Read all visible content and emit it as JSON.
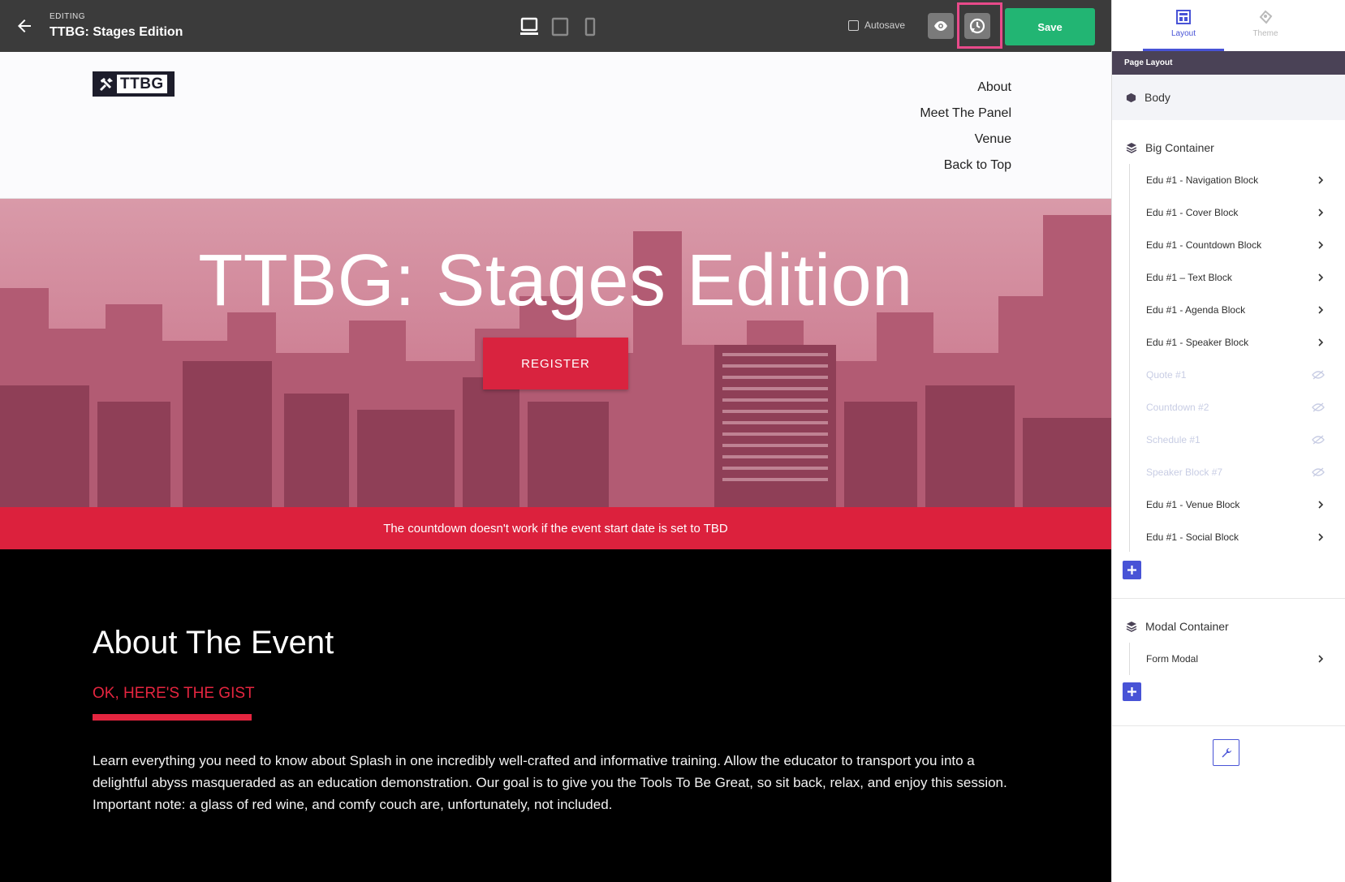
{
  "topbar": {
    "editing_label": "EDITING",
    "title": "TTBG: Stages Edition",
    "autosave_label": "Autosave",
    "save_label": "Save"
  },
  "page": {
    "logo_text": "TTBG",
    "nav_links": [
      "About",
      "Meet The Panel",
      "Venue",
      "Back to Top"
    ],
    "hero_title": "TTBG: Stages Edition",
    "register_label": "REGISTER",
    "countdown_notice": "The countdown doesn't work if the event start date is set to TBD",
    "about": {
      "title": "About The Event",
      "subtitle": "OK, HERE'S THE GIST",
      "body": "Learn everything you need to know about Splash in one incredibly well-crafted and informative training. Allow the educator to transport you into a delightful abyss masqueraded as an education demonstration. Our goal is to give you the Tools To Be Great, so sit back, relax, and enjoy this session. Important note: a glass of red wine, and comfy couch are, unfortunately, not included."
    }
  },
  "sidebar": {
    "tabs": [
      {
        "label": "Layout",
        "active": true
      },
      {
        "label": "Theme",
        "active": false
      }
    ],
    "section_header": "Page Layout",
    "body_label": "Body",
    "big_container": {
      "label": "Big Container",
      "items": [
        {
          "label": "Edu #1 - Navigation Block",
          "hidden": false
        },
        {
          "label": "Edu #1 - Cover Block",
          "hidden": false
        },
        {
          "label": "Edu #1 - Countdown Block",
          "hidden": false
        },
        {
          "label": "Edu #1 – Text Block",
          "hidden": false
        },
        {
          "label": "Edu #1 - Agenda Block",
          "hidden": false
        },
        {
          "label": "Edu #1 - Speaker Block",
          "hidden": false
        },
        {
          "label": "Quote #1",
          "hidden": true
        },
        {
          "label": "Countdown #2",
          "hidden": true
        },
        {
          "label": "Schedule #1",
          "hidden": true
        },
        {
          "label": "Speaker Block #7",
          "hidden": true
        },
        {
          "label": "Edu #1 - Venue Block",
          "hidden": false
        },
        {
          "label": "Edu #1 - Social Block",
          "hidden": false
        }
      ]
    },
    "modal_container": {
      "label": "Modal Container",
      "items": [
        {
          "label": "Form Modal",
          "hidden": false
        }
      ]
    }
  },
  "colors": {
    "accent": "#4853d6",
    "save": "#22b573",
    "brand_red": "#dc213d",
    "highlight": "#e84a8a"
  }
}
